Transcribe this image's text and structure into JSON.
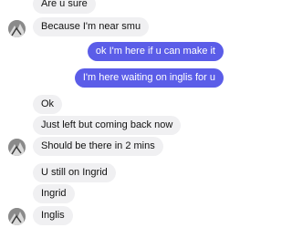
{
  "colors": {
    "incoming_bubble": "#f0f0f2",
    "outgoing_bubble": "#5b5de8",
    "incoming_text": "#111111",
    "outgoing_text": "#ffffff"
  },
  "avatar_icon": "user-avatar-icon",
  "messages": [
    {
      "direction": "in",
      "text": "Are u sure"
    },
    {
      "direction": "in",
      "text": "Because I'm near smu",
      "avatar": true
    },
    {
      "direction": "out",
      "text": "ok I'm here if u can make it"
    },
    {
      "direction": "out",
      "text": "I'm here waiting on inglis for u"
    },
    {
      "direction": "in",
      "text": "Ok"
    },
    {
      "direction": "in",
      "text": "Just left but coming back now"
    },
    {
      "direction": "in",
      "text": "Should be there in 2 mins",
      "avatar": true
    },
    {
      "direction": "in",
      "text": "U still on Ingrid"
    },
    {
      "direction": "in",
      "text": "Ingrid"
    },
    {
      "direction": "in",
      "text": "Inglis",
      "avatar": true
    }
  ]
}
